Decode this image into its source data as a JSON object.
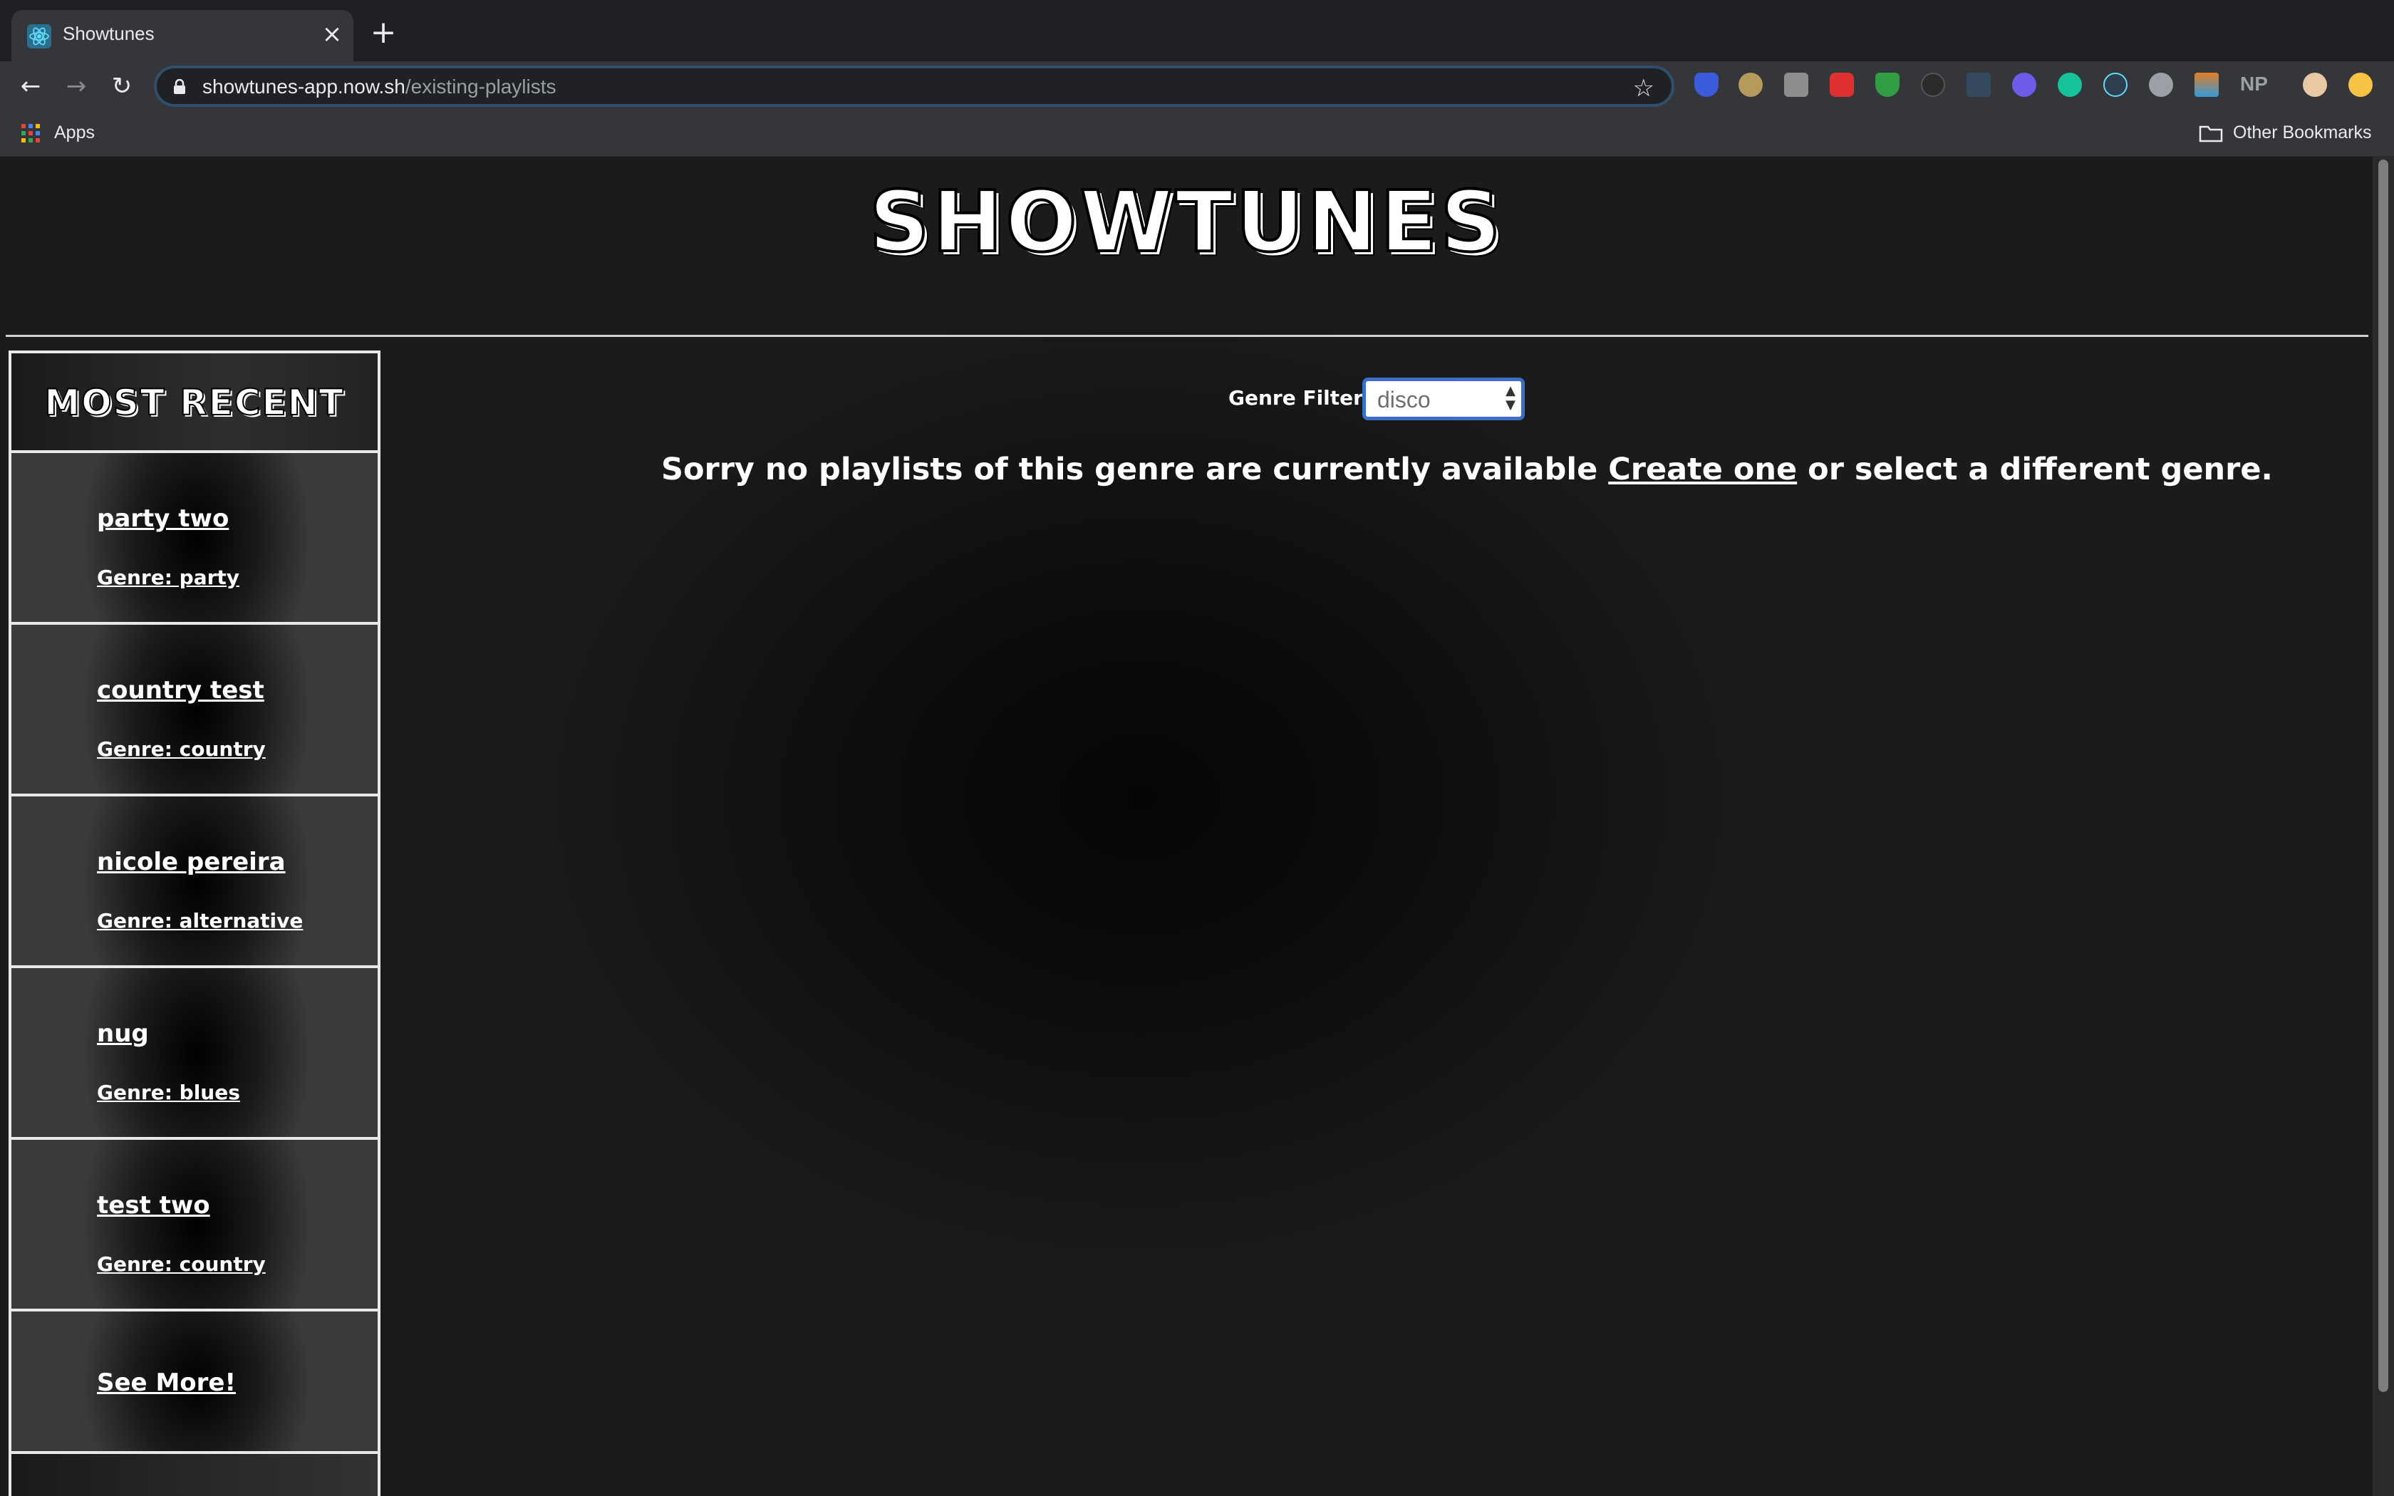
{
  "browser": {
    "tab_title": "Showtunes",
    "tab_close": "×",
    "new_tab": "+",
    "url_host": "showtunes-app.now.sh",
    "url_path": "/existing-playlists",
    "nav_back": "←",
    "nav_forward": "→",
    "nav_reload": "↻",
    "star": "☆",
    "ext_np": "NP",
    "bookmarks": {
      "apps_label": "Apps",
      "other_label": "Other Bookmarks"
    },
    "extension_icons": [
      "shield-icon",
      "bitwarden-icon",
      "translate-icon",
      "ublock-icon",
      "adguard-icon",
      "json-icon",
      "tampermonkey-icon",
      "block-icon",
      "grammarly-icon",
      "react-devtools-icon",
      "speech-bubble-icon",
      "color-palette-icon",
      "np-icon",
      "profile-avatar-icon",
      "star-extension-icon"
    ],
    "colors": {
      "chrome_dark": "#1f2023",
      "chrome_toolbar": "#35363a",
      "omnibox_focus": "#2f4f6d"
    }
  },
  "app": {
    "logo": "SHOWTUNES",
    "sidebar": {
      "title": "MOST RECENT",
      "items": [
        {
          "name": "party two",
          "genre": "Genre: party"
        },
        {
          "name": "country test",
          "genre": "Genre: country"
        },
        {
          "name": "nicole pereira",
          "genre": "Genre: alternative"
        },
        {
          "name": "nug",
          "genre": "Genre: blues"
        },
        {
          "name": "test two",
          "genre": "Genre: country"
        }
      ],
      "see_more": "See More!"
    },
    "filter": {
      "label": "Genre Filter:",
      "selected": "disco"
    },
    "message": {
      "before": "Sorry no playlists of this genre are currently available ",
      "link": "Create one",
      "after": " or select a different genre."
    },
    "colors": {
      "select_focus": "#3a6fc7",
      "text": "#ffffff"
    }
  }
}
